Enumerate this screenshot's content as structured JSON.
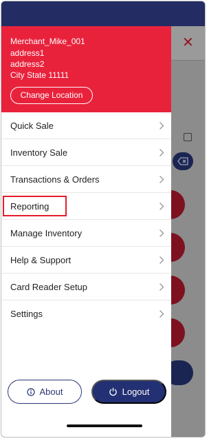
{
  "header": {
    "merchant_name": "Merchant_Mike_001",
    "address1": "address1",
    "address2": "address2",
    "city_state_zip": "City State 11111",
    "change_location_label": "Change Location"
  },
  "menu": {
    "items": [
      {
        "label": "Quick Sale"
      },
      {
        "label": "Inventory Sale"
      },
      {
        "label": "Transactions & Orders"
      },
      {
        "label": "Reporting"
      },
      {
        "label": "Manage Inventory"
      },
      {
        "label": "Help & Support"
      },
      {
        "label": "Card Reader Setup"
      },
      {
        "label": "Settings"
      }
    ],
    "highlighted": "Reporting"
  },
  "footer": {
    "about_label": "About",
    "logout_label": "Logout"
  },
  "icons": {
    "close": "close-icon",
    "chevron": "chevron-right-icon",
    "info": "info-icon",
    "power": "power-icon",
    "edit": "edit-icon",
    "backspace": "backspace-icon"
  },
  "colors": {
    "accent_red": "#e9223c",
    "navy": "#233074",
    "status_bar": "#232d63",
    "highlight": "#e31d2b"
  }
}
